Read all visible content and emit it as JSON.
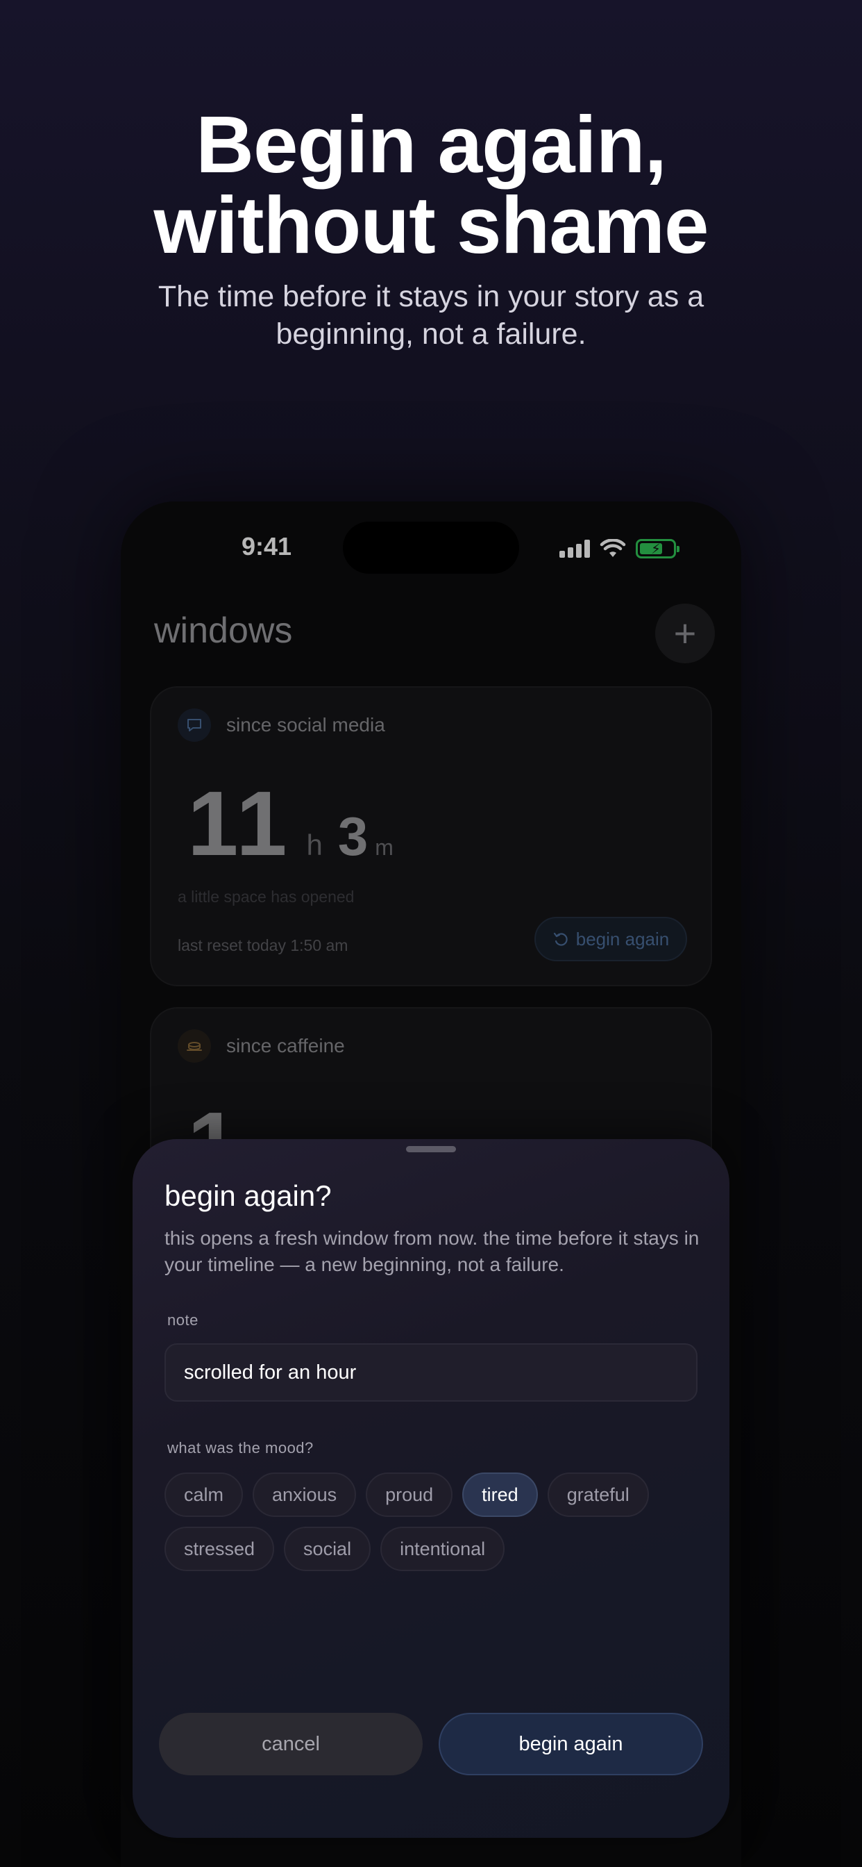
{
  "hero": {
    "title_line1": "Begin again,",
    "title_line2": "without shame",
    "subtitle": "The time before it stays in your story as a beginning, not a failure."
  },
  "status_bar": {
    "time": "9:41",
    "icons": [
      "cellular-signal-icon",
      "wifi-icon",
      "battery-charging-icon"
    ]
  },
  "app": {
    "title": "windows",
    "add_button_symbol": "+"
  },
  "cards": [
    {
      "icon": "chat-bubble-icon",
      "label": "since social media",
      "hours": "11",
      "hours_unit": "h",
      "minutes": "3",
      "minutes_unit": "m",
      "hint": "a little space has opened",
      "last_reset": "last reset today 1:50 am",
      "begin_label": "begin again"
    },
    {
      "icon": "coffee-cup-icon",
      "label": "since caffeine",
      "hours": "1"
    }
  ],
  "sheet": {
    "title": "begin again?",
    "description": "this opens a fresh window from now. the time before it stays in your timeline — a new beginning, not a failure.",
    "note_label": "note",
    "note_value": "scrolled for an hour",
    "mood_label": "what was the mood?",
    "moods": [
      "calm",
      "anxious",
      "proud",
      "tired",
      "grateful",
      "stressed",
      "social",
      "intentional"
    ],
    "selected_mood": "tired",
    "cancel_label": "cancel",
    "confirm_label": "begin again"
  },
  "colors": {
    "accent_blue": "#4d6e9a",
    "battery_green": "#31c758",
    "coffee_icon": "#8a6a3a"
  }
}
